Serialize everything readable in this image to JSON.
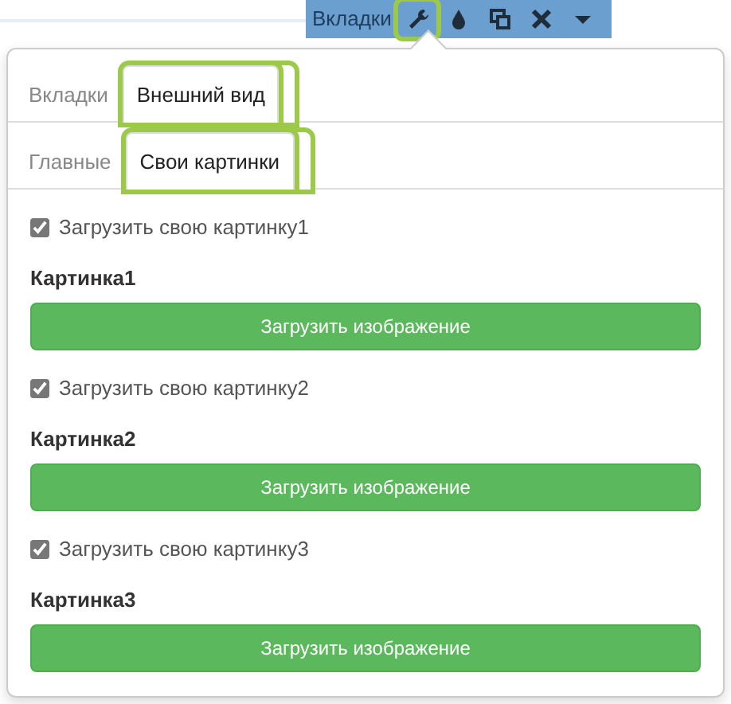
{
  "toolbar": {
    "label": "Вкладки",
    "tools": [
      {
        "kind": "wrench",
        "highlighted": true
      },
      {
        "kind": "drop",
        "highlighted": false
      },
      {
        "kind": "windows",
        "highlighted": false
      },
      {
        "kind": "close",
        "highlighted": false
      },
      {
        "kind": "caret",
        "highlighted": false
      }
    ]
  },
  "tabs": [
    {
      "label": "Вкладки",
      "selected": false,
      "highlighted": false
    },
    {
      "label": "Внешний вид",
      "selected": true,
      "highlighted": true
    }
  ],
  "subtabs": [
    {
      "label": "Главные",
      "selected": false,
      "highlighted": false
    },
    {
      "label": "Свои картинки",
      "selected": true,
      "highlighted": true
    }
  ],
  "items": [
    {
      "checkbox_label": "Загрузить свою картинку1",
      "checked": true,
      "heading": "Картинка1",
      "button": "Загрузить изображение"
    },
    {
      "checkbox_label": "Загрузить свою картинку2",
      "checked": true,
      "heading": "Картинка2",
      "button": "Загрузить изображение"
    },
    {
      "checkbox_label": "Загрузить свою картинку3",
      "checked": true,
      "heading": "Картинка3",
      "button": "Загрузить изображение"
    }
  ]
}
